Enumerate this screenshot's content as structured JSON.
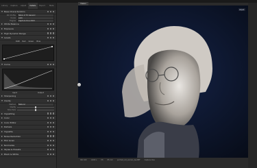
{
  "left": {
    "tabs": [
      "Library",
      "Capture",
      "Adjust",
      "Details",
      "Export",
      "Meta"
    ],
    "active_tab": 3,
    "sections": {
      "base": "Base Characteristics",
      "white_balance": "White Balance",
      "exposure": "Exposure",
      "hdr": "High Dynamic Range",
      "levels": "Levels",
      "curve": "Curve",
      "sharpening": "Sharpening",
      "clarity": "Clarity",
      "vignetting": "Vignetting",
      "color": "Color",
      "color_editor": "Color Editor",
      "dehaze": "Dehaze",
      "vignette2": "Vignette",
      "noise": "Noise Reduction",
      "film": "Film Grain",
      "normalize": "Normalize",
      "styles": "Styles & Presets",
      "black_white": "Black & White"
    },
    "base_rows": [
      {
        "k": "ICC Profile",
        "v": "Nikon Z 7II Generic"
      },
      {
        "k": "Curve",
        "v": "Auto"
      },
      {
        "k": "Engine",
        "v": "Capture One 2023"
      }
    ],
    "levels_tabs": [
      "RGB",
      "Red",
      "Green",
      "Blue"
    ],
    "curve_labels": {
      "input": "Input",
      "output": "Output"
    },
    "clarity_rows": [
      {
        "k": "Method",
        "v": "Natural"
      },
      {
        "k": "Clarity",
        "v": "0"
      },
      {
        "k": "Structure",
        "v": "0"
      }
    ]
  },
  "viewer": {
    "label": "Viewer",
    "corner": "Adjust",
    "status": [
      "ISO 100",
      "1/200 s",
      "f/8",
      "85 mm",
      "portrait_old_woman_bw.NEF",
      "Capture One"
    ]
  }
}
